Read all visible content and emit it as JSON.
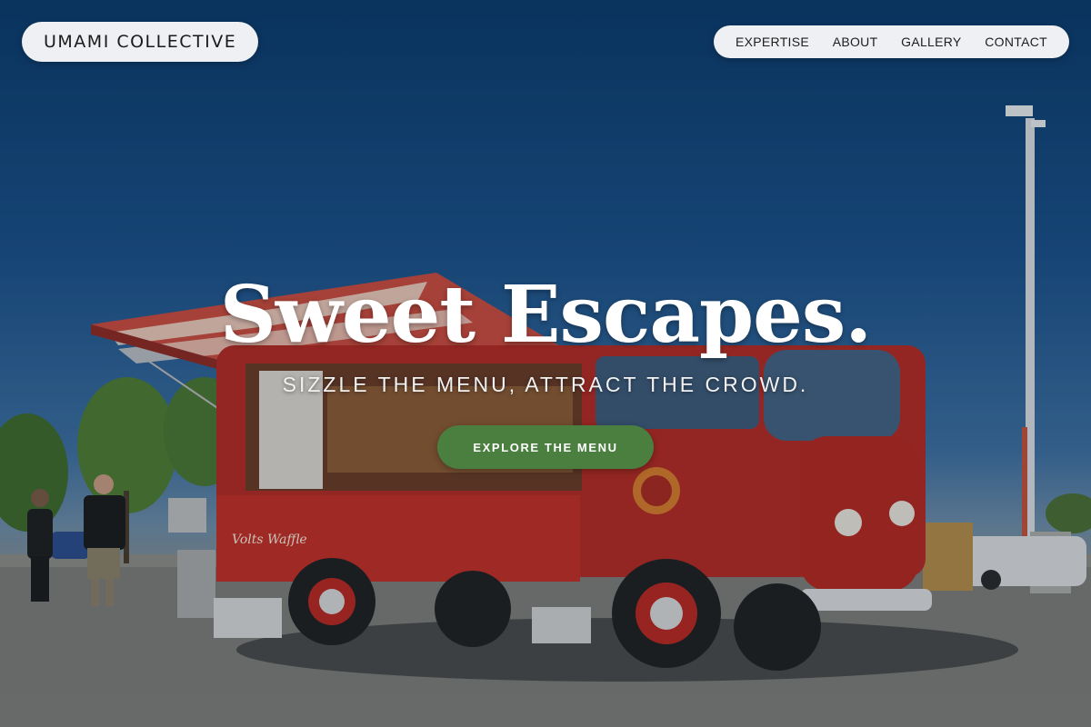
{
  "brand": {
    "name": "UMAMI COLLECTIVE"
  },
  "nav": {
    "items": [
      "EXPERTISE",
      "ABOUT",
      "GALLERY",
      "CONTACT"
    ]
  },
  "hero": {
    "headline": "Sweet Escapes.",
    "tagline": "SIZZLE THE MENU, ATTRACT THE CROWD.",
    "cta_label": "EXPLORE THE MENU",
    "van_sign": "Volts Waffle"
  },
  "colors": {
    "accent": "#4a7f3f",
    "pill_bg": "#eef0f3",
    "van_red": "#b32a22",
    "sky": "#0b3a6a"
  }
}
